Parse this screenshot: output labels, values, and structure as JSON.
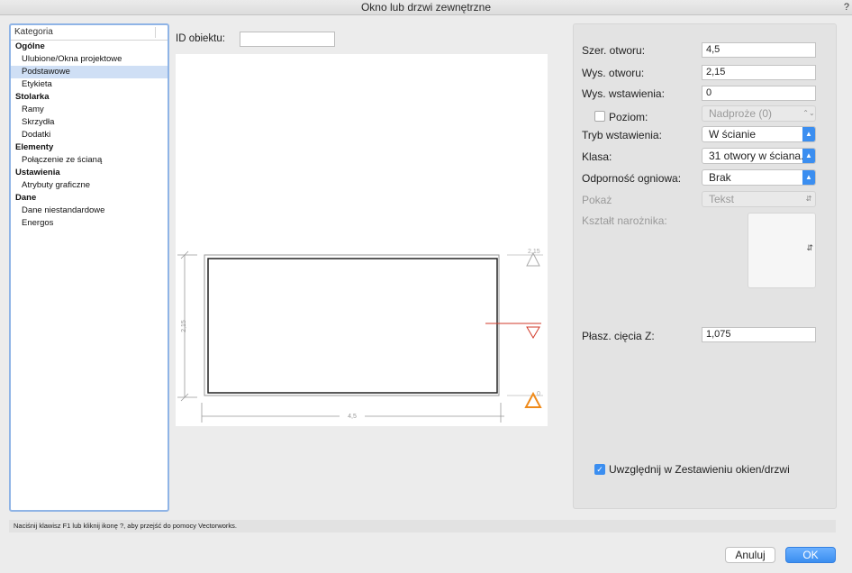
{
  "window": {
    "title": "Okno lub drzwi zewnętrzne",
    "help": "?"
  },
  "categories": {
    "header": "Kategoria",
    "items": [
      {
        "label": "Ogólne",
        "type": "group"
      },
      {
        "label": "Ulubione/Okna projektowe",
        "type": "sub"
      },
      {
        "label": "Podstawowe",
        "type": "sub",
        "selected": true
      },
      {
        "label": "Etykieta",
        "type": "sub"
      },
      {
        "label": "Stolarka",
        "type": "group"
      },
      {
        "label": "Ramy",
        "type": "sub"
      },
      {
        "label": "Skrzydła",
        "type": "sub"
      },
      {
        "label": "Dodatki",
        "type": "sub"
      },
      {
        "label": "Elementy",
        "type": "group"
      },
      {
        "label": "Połączenie ze ścianą",
        "type": "sub"
      },
      {
        "label": "Ustawienia",
        "type": "group"
      },
      {
        "label": "Atrybuty graficzne",
        "type": "sub"
      },
      {
        "label": "Dane",
        "type": "group"
      },
      {
        "label": "Dane niestandardowe",
        "type": "sub"
      },
      {
        "label": "Energos",
        "type": "sub"
      }
    ]
  },
  "object": {
    "id_label": "ID obiektu:",
    "id_value": ""
  },
  "preview": {
    "width_dim": "4,5",
    "height_dim": "2,15",
    "top_mark": "2,15",
    "bottom_mark": "0"
  },
  "settings": {
    "szer_label": "Szer. otworu:",
    "szer_value": "4,5",
    "wys_label": "Wys. otworu:",
    "wys_value": "2,15",
    "wst_label": "Wys. wstawienia:",
    "wst_value": "0",
    "poziom_label": "Poziom:",
    "poziom_value": "Nadproże (0)",
    "tryb_label": "Tryb wstawienia:",
    "tryb_value": "W ścianie",
    "klasa_label": "Klasa:",
    "klasa_value": "31 otwory w ściana...",
    "odp_label": "Odporność ogniowa:",
    "odp_value": "Brak",
    "pokaz_label": "Pokaż",
    "pokaz_value": "Tekst",
    "ksztalt_label": "Kształt narożnika:",
    "plasz_label": "Płasz. cięcia Z:",
    "plasz_value": "1,075",
    "uwzgl_label": "Uwzględnij w Zestawieniu okien/drzwi"
  },
  "status": "Naciśnij klawisz F1 lub kliknij ikonę ?, aby przejść do pomocy Vectorworks.",
  "buttons": {
    "cancel": "Anuluj",
    "ok": "OK"
  },
  "colors": {
    "accent": "#3b8ef0",
    "preview_marker_red": "#d23a2a",
    "preview_marker_orange": "#ef8a1a"
  }
}
